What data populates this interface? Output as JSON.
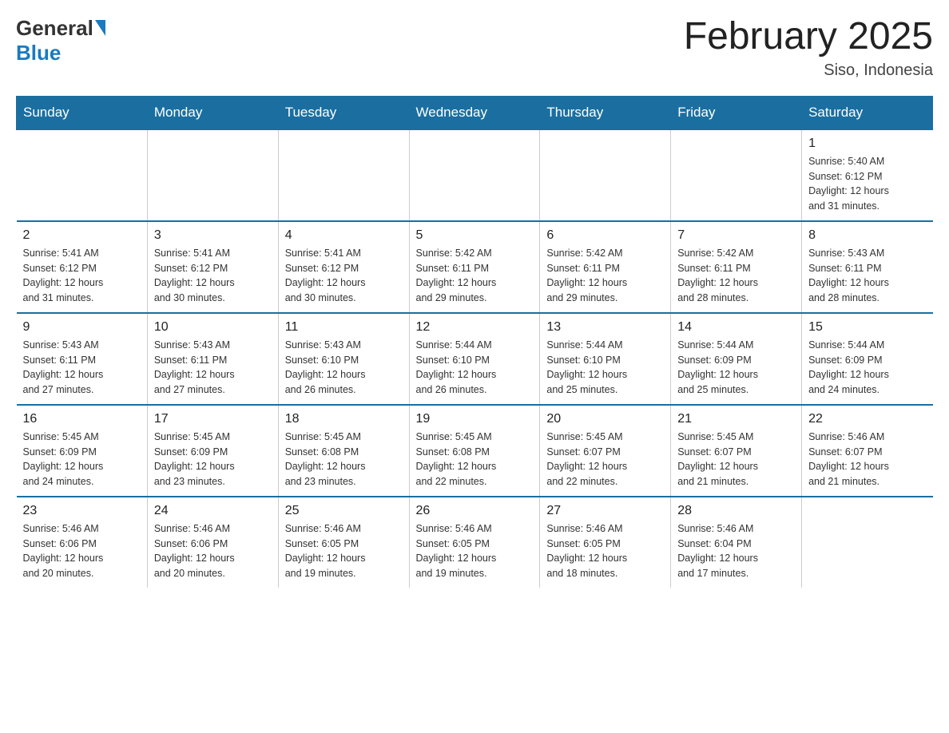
{
  "logo": {
    "general": "General",
    "blue": "Blue"
  },
  "title": {
    "month_year": "February 2025",
    "location": "Siso, Indonesia"
  },
  "headers": [
    "Sunday",
    "Monday",
    "Tuesday",
    "Wednesday",
    "Thursday",
    "Friday",
    "Saturday"
  ],
  "weeks": [
    [
      {
        "day": "",
        "info": ""
      },
      {
        "day": "",
        "info": ""
      },
      {
        "day": "",
        "info": ""
      },
      {
        "day": "",
        "info": ""
      },
      {
        "day": "",
        "info": ""
      },
      {
        "day": "",
        "info": ""
      },
      {
        "day": "1",
        "info": "Sunrise: 5:40 AM\nSunset: 6:12 PM\nDaylight: 12 hours\nand 31 minutes."
      }
    ],
    [
      {
        "day": "2",
        "info": "Sunrise: 5:41 AM\nSunset: 6:12 PM\nDaylight: 12 hours\nand 31 minutes."
      },
      {
        "day": "3",
        "info": "Sunrise: 5:41 AM\nSunset: 6:12 PM\nDaylight: 12 hours\nand 30 minutes."
      },
      {
        "day": "4",
        "info": "Sunrise: 5:41 AM\nSunset: 6:12 PM\nDaylight: 12 hours\nand 30 minutes."
      },
      {
        "day": "5",
        "info": "Sunrise: 5:42 AM\nSunset: 6:11 PM\nDaylight: 12 hours\nand 29 minutes."
      },
      {
        "day": "6",
        "info": "Sunrise: 5:42 AM\nSunset: 6:11 PM\nDaylight: 12 hours\nand 29 minutes."
      },
      {
        "day": "7",
        "info": "Sunrise: 5:42 AM\nSunset: 6:11 PM\nDaylight: 12 hours\nand 28 minutes."
      },
      {
        "day": "8",
        "info": "Sunrise: 5:43 AM\nSunset: 6:11 PM\nDaylight: 12 hours\nand 28 minutes."
      }
    ],
    [
      {
        "day": "9",
        "info": "Sunrise: 5:43 AM\nSunset: 6:11 PM\nDaylight: 12 hours\nand 27 minutes."
      },
      {
        "day": "10",
        "info": "Sunrise: 5:43 AM\nSunset: 6:11 PM\nDaylight: 12 hours\nand 27 minutes."
      },
      {
        "day": "11",
        "info": "Sunrise: 5:43 AM\nSunset: 6:10 PM\nDaylight: 12 hours\nand 26 minutes."
      },
      {
        "day": "12",
        "info": "Sunrise: 5:44 AM\nSunset: 6:10 PM\nDaylight: 12 hours\nand 26 minutes."
      },
      {
        "day": "13",
        "info": "Sunrise: 5:44 AM\nSunset: 6:10 PM\nDaylight: 12 hours\nand 25 minutes."
      },
      {
        "day": "14",
        "info": "Sunrise: 5:44 AM\nSunset: 6:09 PM\nDaylight: 12 hours\nand 25 minutes."
      },
      {
        "day": "15",
        "info": "Sunrise: 5:44 AM\nSunset: 6:09 PM\nDaylight: 12 hours\nand 24 minutes."
      }
    ],
    [
      {
        "day": "16",
        "info": "Sunrise: 5:45 AM\nSunset: 6:09 PM\nDaylight: 12 hours\nand 24 minutes."
      },
      {
        "day": "17",
        "info": "Sunrise: 5:45 AM\nSunset: 6:09 PM\nDaylight: 12 hours\nand 23 minutes."
      },
      {
        "day": "18",
        "info": "Sunrise: 5:45 AM\nSunset: 6:08 PM\nDaylight: 12 hours\nand 23 minutes."
      },
      {
        "day": "19",
        "info": "Sunrise: 5:45 AM\nSunset: 6:08 PM\nDaylight: 12 hours\nand 22 minutes."
      },
      {
        "day": "20",
        "info": "Sunrise: 5:45 AM\nSunset: 6:07 PM\nDaylight: 12 hours\nand 22 minutes."
      },
      {
        "day": "21",
        "info": "Sunrise: 5:45 AM\nSunset: 6:07 PM\nDaylight: 12 hours\nand 21 minutes."
      },
      {
        "day": "22",
        "info": "Sunrise: 5:46 AM\nSunset: 6:07 PM\nDaylight: 12 hours\nand 21 minutes."
      }
    ],
    [
      {
        "day": "23",
        "info": "Sunrise: 5:46 AM\nSunset: 6:06 PM\nDaylight: 12 hours\nand 20 minutes."
      },
      {
        "day": "24",
        "info": "Sunrise: 5:46 AM\nSunset: 6:06 PM\nDaylight: 12 hours\nand 20 minutes."
      },
      {
        "day": "25",
        "info": "Sunrise: 5:46 AM\nSunset: 6:05 PM\nDaylight: 12 hours\nand 19 minutes."
      },
      {
        "day": "26",
        "info": "Sunrise: 5:46 AM\nSunset: 6:05 PM\nDaylight: 12 hours\nand 19 minutes."
      },
      {
        "day": "27",
        "info": "Sunrise: 5:46 AM\nSunset: 6:05 PM\nDaylight: 12 hours\nand 18 minutes."
      },
      {
        "day": "28",
        "info": "Sunrise: 5:46 AM\nSunset: 6:04 PM\nDaylight: 12 hours\nand 17 minutes."
      },
      {
        "day": "",
        "info": ""
      }
    ]
  ]
}
